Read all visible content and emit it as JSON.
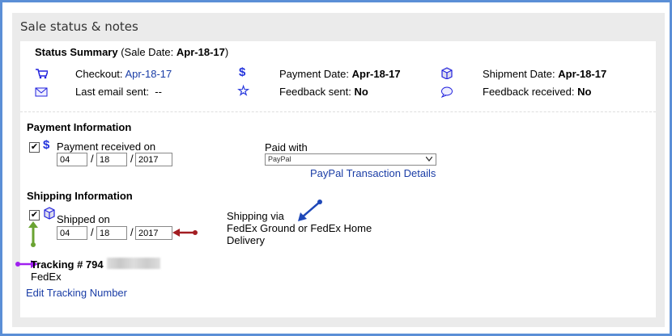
{
  "title": "Sale status & notes",
  "summary": {
    "label": "Status Summary",
    "sale_date_label": "(Sale Date:",
    "sale_date": "Apr-18-17",
    "close": ")",
    "checkout_label": "Checkout:",
    "checkout": "Apr-18-17",
    "payment_label": "Payment Date:",
    "payment": "Apr-18-17",
    "shipment_label": "Shipment Date:",
    "shipment": "Apr-18-17",
    "email_label": "Last email sent:",
    "email": "--",
    "fb_sent_label": "Feedback sent:",
    "fb_sent": "No",
    "fb_recv_label": "Feedback received:",
    "fb_recv": "No"
  },
  "payment": {
    "heading": "Payment Information",
    "received_label": "Payment received on",
    "month": "04",
    "day": "18",
    "year": "2017",
    "sep": "/",
    "paid_with_label": "Paid with",
    "paid_with": "PayPal",
    "paypal_link": "PayPal Transaction Details"
  },
  "shipping": {
    "heading": "Shipping Information",
    "shipped_label": "Shipped on",
    "month": "04",
    "day": "18",
    "year": "2017",
    "sep": "/",
    "via_label": "Shipping via",
    "via": "FedEx Ground or FedEx Home",
    "via2": "Delivery",
    "tracking_label": "Tracking # 794",
    "carrier": "FedEx",
    "edit_link": "Edit Tracking Number"
  },
  "icons": {
    "checkmark": "✔",
    "dollar": "$",
    "star": "☆"
  }
}
